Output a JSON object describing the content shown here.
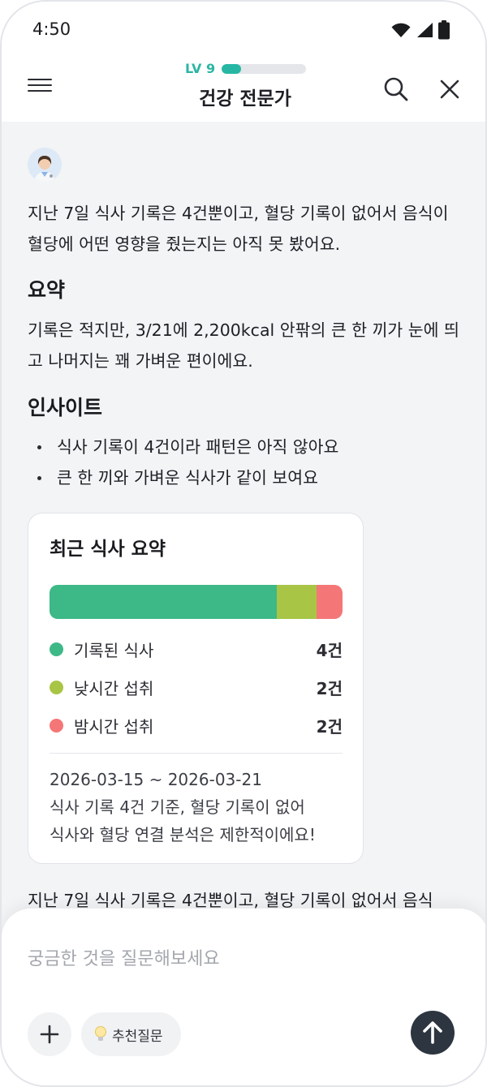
{
  "status_bar": {
    "time": "4:50"
  },
  "header": {
    "level_label": "LV 9",
    "level_progress": 0.23,
    "title": "건강 전문가"
  },
  "chat": {
    "avatar_icon": "doctor-avatar-icon",
    "intro": "지난 7일 식사 기록은 4건뿐이고, 혈당 기록이 없어서 음식이 혈당에 어떤 영향을 줬는지는 아직 못 봤어요.",
    "summary_heading": "요약",
    "summary_text": "기록은 적지만, 3/21에 2,200kcal 안팎의 큰 한 끼가 눈에 띄고 나머지는 꽤 가벼운 편이에요.",
    "insight_heading": "인사이트",
    "insights": [
      "식사 기록이 4건이라 패턴은 아직 않아요",
      "큰 한 끼와 가벼운 식사가 같이 보여요"
    ],
    "footer_text": "지난 7일 식사 기록은 4건뿐이고, 혈당 기록이 없어서 음식"
  },
  "card": {
    "title": "최근 식사 요약",
    "bar_segments": [
      {
        "key": "recorded",
        "fraction": 0.775,
        "color": "#3db887"
      },
      {
        "key": "daytime",
        "fraction": 0.135,
        "color": "#a8c545"
      },
      {
        "key": "night",
        "fraction": 0.09,
        "color": "#f47676"
      }
    ],
    "legend": [
      {
        "label": "기록된 식사",
        "value": "4건",
        "color": "#3db887"
      },
      {
        "label": "낮시간 섭취",
        "value": "2건",
        "color": "#a8c545"
      },
      {
        "label": "밤시간 섭취",
        "value": "2건",
        "color": "#f47676"
      }
    ],
    "date_range": "2026-03-15 ~ 2026-03-21",
    "note_line1": "식사 기록 4건 기준, 혈당 기록이 없어",
    "note_line2": "식사와 혈당 연결 분석은 제한적이에요!"
  },
  "input": {
    "placeholder": "궁금한 것을 질문해보세요",
    "suggest_label": "추천질문"
  },
  "colors": {
    "accent": "#26b7a4",
    "send_button": "#2d3541"
  }
}
